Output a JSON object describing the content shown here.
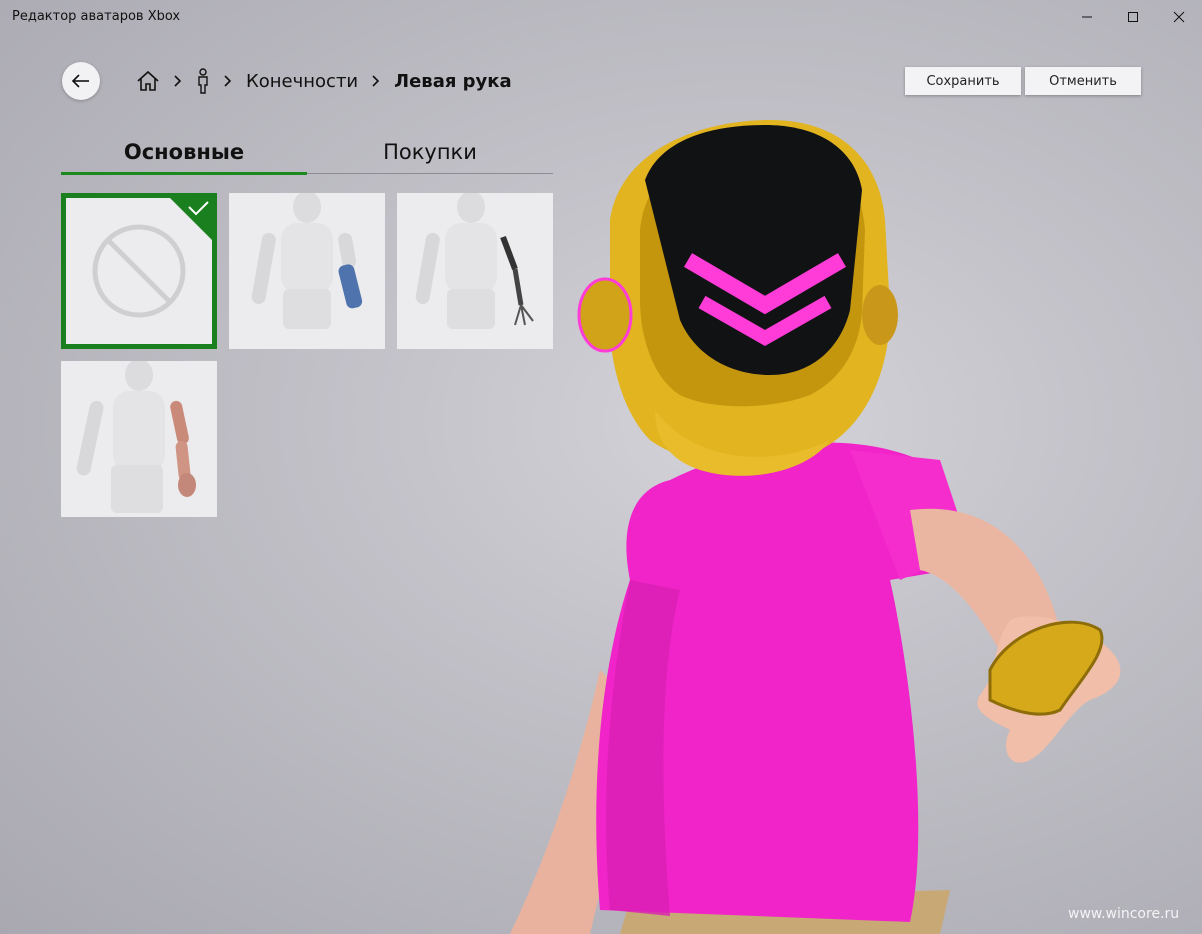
{
  "window": {
    "title": "Редактор аватаров Xbox",
    "controls": [
      "minimize-icon",
      "maximize-icon",
      "close-icon"
    ]
  },
  "breadcrumb": {
    "items": [
      "home-icon",
      "person-icon",
      "Конечности",
      "Левая рука"
    ]
  },
  "actions": {
    "save_label": "Сохранить",
    "cancel_label": "Отменить"
  },
  "tabs": [
    {
      "label": "Основные",
      "selected": true
    },
    {
      "label": "Покупки",
      "selected": false
    }
  ],
  "items": [
    {
      "name": "none",
      "icon": "prohibited-icon",
      "selected": true
    },
    {
      "name": "blue-cast-arm",
      "selected": false
    },
    {
      "name": "robotic-arm",
      "selected": false
    },
    {
      "name": "mechanical-copper-arm",
      "selected": false
    }
  ],
  "colors": {
    "accent": "#1b8a1e",
    "background": "#c1c0c7"
  },
  "watermark": "www.wincore.ru"
}
